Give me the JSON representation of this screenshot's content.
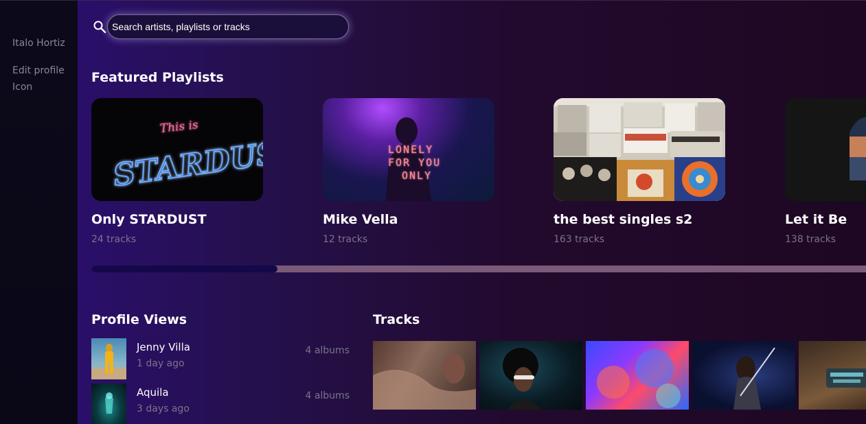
{
  "sidebar": {
    "user_name": "Italo Hortiz",
    "edit_profile": "Edit profile",
    "icon_link": "Icon"
  },
  "search": {
    "placeholder": "Search artists, playlists or tracks",
    "icon": "search-icon"
  },
  "featured": {
    "title": "Featured Playlists",
    "playlists": [
      {
        "name": "Only STARDUST",
        "tracks": "24 tracks",
        "cover_text_top": "This is",
        "cover_text_main": "STARDUST"
      },
      {
        "name": "Mike Vella",
        "tracks": "12 tracks",
        "cover_text": [
          "LONELY",
          "FOR YOU",
          "ONLY"
        ]
      },
      {
        "name": "the best singles s2",
        "tracks": "163 tracks"
      },
      {
        "name": "Let it Be",
        "tracks": "138 tracks"
      }
    ],
    "scroll_position": 0.24
  },
  "profile_views": {
    "title": "Profile Views",
    "items": [
      {
        "name": "Jenny Villa",
        "time": "1 day ago",
        "albums": "4 albums"
      },
      {
        "name": "Aquila",
        "time": "3 days ago",
        "albums": "4 albums"
      }
    ]
  },
  "tracks": {
    "title": "Tracks",
    "items": [
      {
        "label": ""
      },
      {
        "label": ""
      },
      {
        "label": ""
      },
      {
        "label": ""
      },
      {
        "label": ""
      }
    ]
  },
  "colors": {
    "accent": "#15084a",
    "background_left": "#2a0f6a",
    "background_right": "#1e0722",
    "muted_text": "#7a7488"
  }
}
